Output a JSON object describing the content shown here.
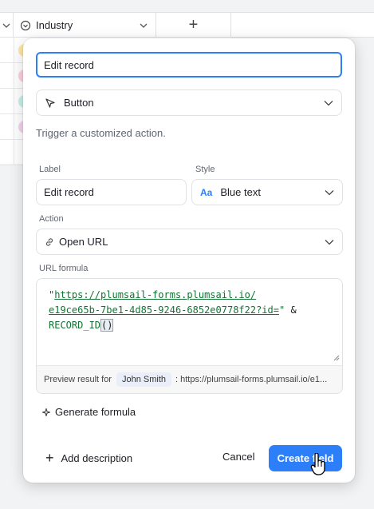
{
  "grid": {
    "industry_header": "Industry",
    "add_column": "+",
    "row_pill_colors": [
      "#fde6a8",
      "#fbd0e0",
      "#c8f0ea",
      "#f2d4f0"
    ]
  },
  "dialog": {
    "field_name_value": "Edit record",
    "field_type": "Button",
    "helper_text": "Trigger a customized action.",
    "label_caption": "Label",
    "label_value": "Edit record",
    "style_caption": "Style",
    "style_icon": "Aa",
    "style_value": "Blue text",
    "action_caption": "Action",
    "action_value": "Open URL",
    "url_formula_caption": "URL formula",
    "formula": {
      "url_line1": "https://plumsail-forms.plumsail.io/",
      "url_line2": "e19ce65b-7be1-4d85-9246-6852e0778f22?id=",
      "operator": "&",
      "func": "RECORD_ID",
      "parens": "()"
    },
    "preview_label": "Preview result for",
    "preview_record": "John Smith",
    "preview_result": ": https://plumsail-forms.plumsail.io/e1...",
    "generate_formula": "Generate formula",
    "add_description": "Add description",
    "cancel": "Cancel",
    "create_field": "Create field"
  },
  "colors": {
    "accent": "#2d7ff9",
    "formula_green": "#137333"
  }
}
